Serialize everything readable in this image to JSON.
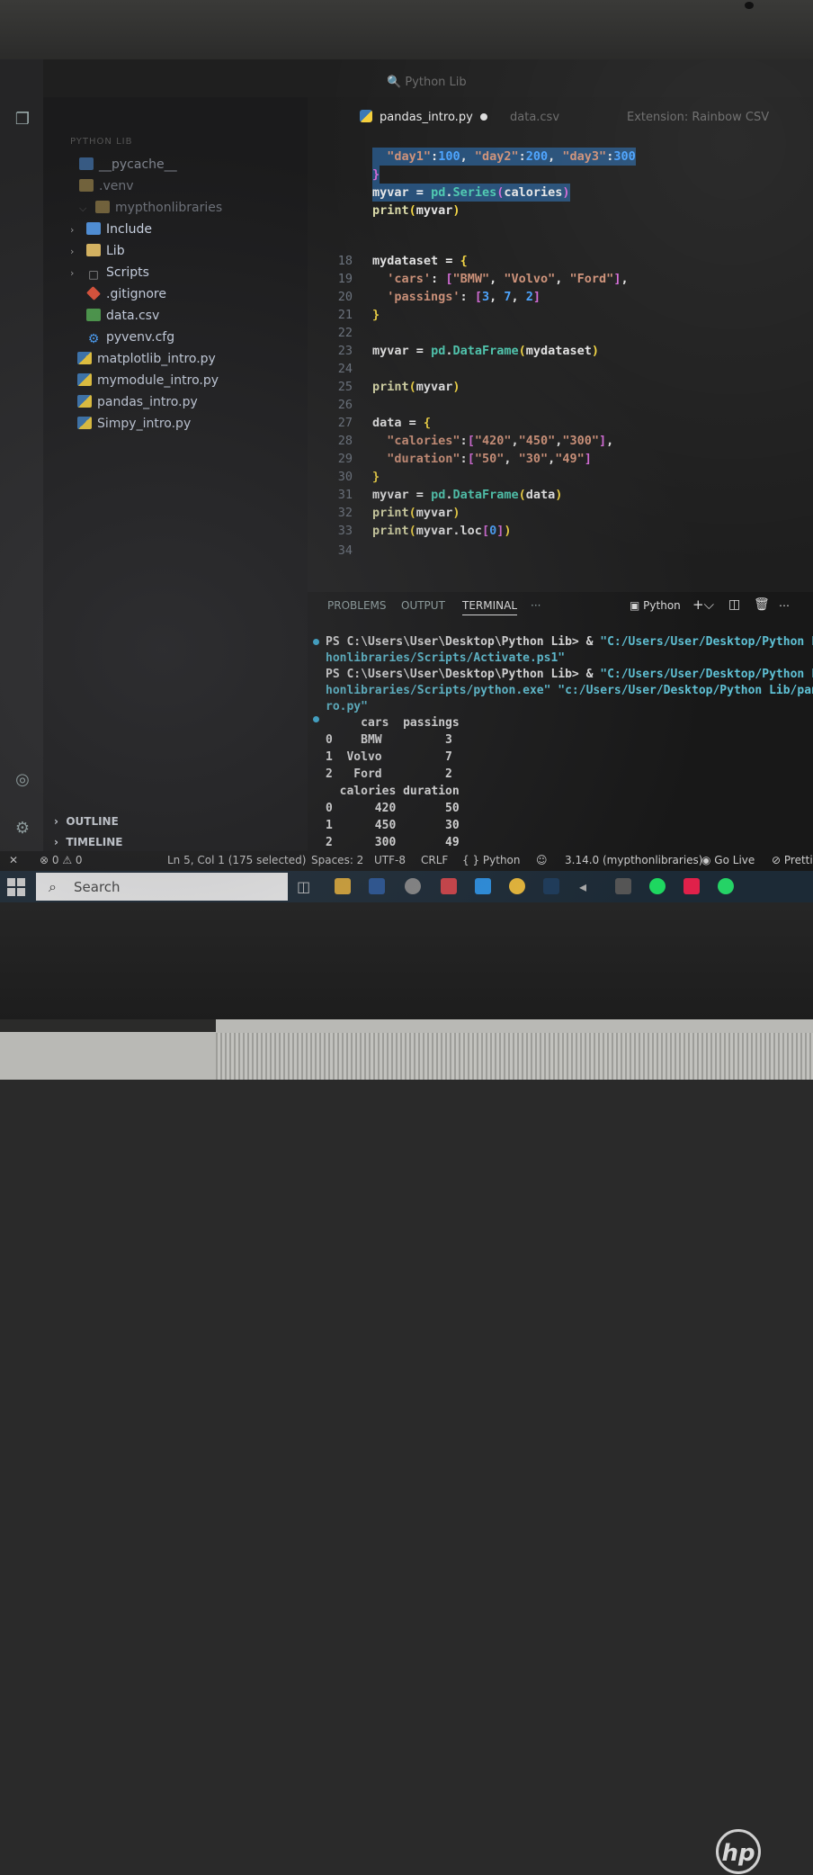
{
  "explorer": {
    "section": "PYTHON LIB",
    "items": [
      {
        "label": "__pycache__",
        "icon": "folder-icon"
      },
      {
        "label": ".venv",
        "icon": "folder-icon"
      },
      {
        "label": "mypthonlibraries",
        "icon": "folder-icon"
      },
      {
        "label": "Include",
        "icon": "folder-icon"
      },
      {
        "label": "Lib",
        "icon": "folder-icon"
      },
      {
        "label": "Scripts",
        "icon": "folder-icon"
      },
      {
        "label": ".gitignore",
        "icon": "git-icon"
      },
      {
        "label": "data.csv",
        "icon": "csv-icon"
      },
      {
        "label": "pyvenv.cfg",
        "icon": "gear-icon"
      },
      {
        "label": "matplotlib_intro.py",
        "icon": "python-icon"
      },
      {
        "label": "mymodule_intro.py",
        "icon": "python-icon"
      },
      {
        "label": "pandas_intro.py",
        "icon": "python-icon"
      },
      {
        "label": "Simpy_intro.py",
        "icon": "python-icon"
      }
    ],
    "outline": "OUTLINE",
    "timeline": "TIMELINE"
  },
  "title_search": "Python Lib",
  "tabs": {
    "active": "pandas_intro.py",
    "second": "data.csv",
    "third": "Extension: Rainbow CSV"
  },
  "line_numbers": [
    "18",
    "19",
    "20",
    "21",
    "22",
    "23",
    "24",
    "25",
    "26",
    "27",
    "28",
    "29",
    "30",
    "31",
    "32",
    "33",
    "34"
  ],
  "panel": {
    "tabs": [
      "PROBLEMS",
      "OUTPUT",
      "TERMINAL",
      "···"
    ],
    "terminal_name": "Python",
    "lines": [
      {
        "prompt": "PS C:\\Users\\User\\Desktop\\Python Lib> & ",
        "path": "\"C:/Users/User/Desktop/Python Lib"
      },
      {
        "prompt": "",
        "path": "honlibraries/Scripts/Activate.ps1\""
      },
      {
        "prompt": "PS C:\\Users\\User\\Desktop\\Python Lib> & ",
        "path": "\"C:/Users/User/Desktop/Python Lib"
      },
      {
        "prompt": "",
        "path": "honlibraries/Scripts/python.exe\" \"c:/Users/User/Desktop/Python Lib/panda"
      },
      {
        "prompt": "",
        "path": "ro.py\""
      },
      {
        "prompt": "     cars  passings",
        "path": ""
      },
      {
        "prompt": "0    BMW         3",
        "path": ""
      },
      {
        "prompt": "1  Volvo         7",
        "path": ""
      },
      {
        "prompt": "2   Ford         2",
        "path": ""
      },
      {
        "prompt": "  calories duration",
        "path": ""
      },
      {
        "prompt": "0      420       50",
        "path": ""
      },
      {
        "prompt": "1      450       30",
        "path": ""
      },
      {
        "prompt": "2      300       49",
        "path": ""
      }
    ]
  },
  "status": {
    "errors": "0",
    "warnings": "0",
    "position": "Ln 5, Col 1 (175 selected)",
    "spaces": "Spaces: 2",
    "encoding": "UTF-8",
    "eol": "CRLF",
    "language": "Python",
    "interpreter": "3.14.0 (mypthonlibraries)",
    "golive": "Go Live",
    "prettier": "Pretti"
  },
  "taskbar": {
    "search": "Search"
  },
  "brand": "hp"
}
